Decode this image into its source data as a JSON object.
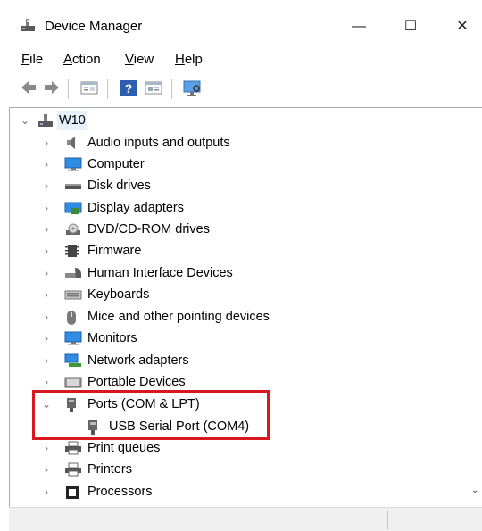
{
  "window": {
    "title": "Device Manager",
    "minimize": "—",
    "maximize": "☐",
    "close": "✕"
  },
  "menu": [
    {
      "label": "File",
      "accel": "F",
      "rest": "ile"
    },
    {
      "label": "Action",
      "accel": "A",
      "rest": "ction"
    },
    {
      "label": "View",
      "accel": "V",
      "rest": "iew"
    },
    {
      "label": "Help",
      "accel": "H",
      "rest": "elp"
    }
  ],
  "tree": {
    "root": "W10",
    "categories": [
      {
        "label": "Audio inputs and outputs",
        "icon": "speaker-icon"
      },
      {
        "label": "Computer",
        "icon": "computer-icon"
      },
      {
        "label": "Disk drives",
        "icon": "disk-drive-icon"
      },
      {
        "label": "Display adapters",
        "icon": "display-adapter-icon"
      },
      {
        "label": "DVD/CD-ROM drives",
        "icon": "dvd-drive-icon"
      },
      {
        "label": "Firmware",
        "icon": "firmware-icon"
      },
      {
        "label": "Human Interface Devices",
        "icon": "hid-icon"
      },
      {
        "label": "Keyboards",
        "icon": "keyboard-icon"
      },
      {
        "label": "Mice and other pointing devices",
        "icon": "mouse-icon"
      },
      {
        "label": "Monitors",
        "icon": "monitor-icon"
      },
      {
        "label": "Network adapters",
        "icon": "network-adapter-icon"
      },
      {
        "label": "Portable Devices",
        "icon": "portable-device-icon"
      },
      {
        "label": "Ports (COM & LPT)",
        "icon": "port-icon"
      },
      {
        "label": "USB Serial Port (COM4)",
        "icon": "port-icon"
      },
      {
        "label": "Print queues",
        "icon": "printer-icon"
      },
      {
        "label": "Printers",
        "icon": "printer-icon"
      },
      {
        "label": "Processors",
        "icon": "processor-icon"
      }
    ]
  }
}
